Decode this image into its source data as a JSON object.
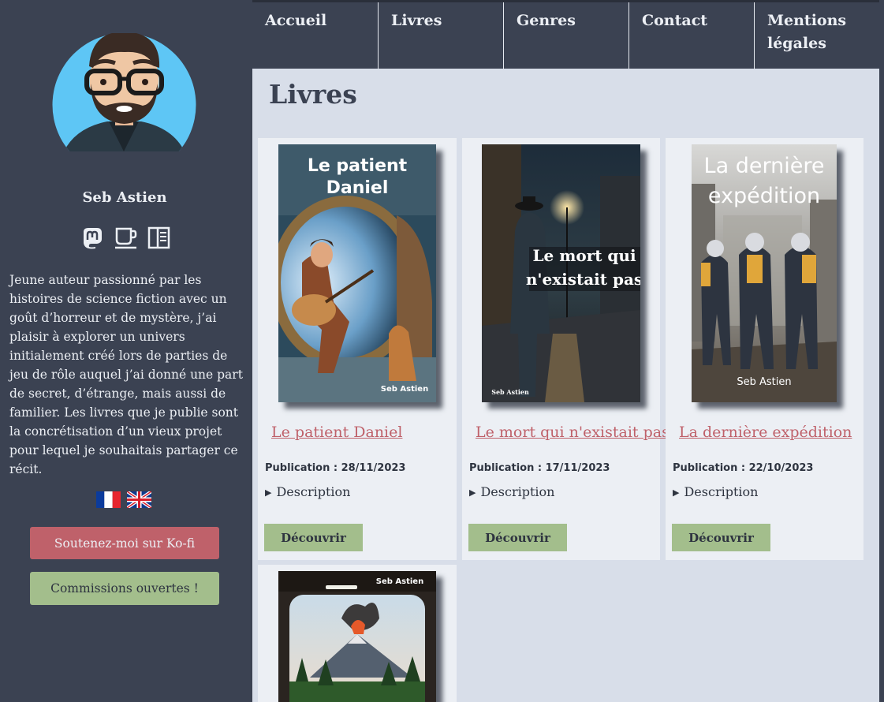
{
  "nav": {
    "items": [
      {
        "label": "Accueil"
      },
      {
        "label": "Livres"
      },
      {
        "label": "Genres"
      },
      {
        "label": "Contact"
      },
      {
        "label": "Mentions légales"
      }
    ]
  },
  "sidebar": {
    "author_name": "Seb Astien",
    "social_icons": [
      "mastodon-icon",
      "coffee-cup-icon",
      "book-icon"
    ],
    "bio": "Jeune auteur passionné par les histoires de science fiction avec un goût d’horreur et de mystère, j’ai plaisir à explorer un univers initialement créé lors de parties de jeu de rôle auquel j’ai donné une part de secret, d’étrange, mais aussi de familier. Les livres que je publie sont la concrétisation d’un vieux projet pour lequel je souhaitais partager ce récit.",
    "flags": [
      "french-flag-icon",
      "uk-flag-icon"
    ],
    "kofi_button": "Soutenez-moi sur Ko-fi",
    "commissions_button": "Commissions ouvertes !"
  },
  "main": {
    "title": "Livres",
    "books": [
      {
        "title": "Le patient Daniel",
        "cover_title": "Le patient Daniel",
        "cover_author": "Seb Astien",
        "date_label": "Publication :",
        "date": "28/11/2023",
        "description_label": "Description",
        "button": "Découvrir"
      },
      {
        "title": "Le mort qui n'existait pas",
        "cover_title": "Le mort qui n'existait pas",
        "cover_author": "Seb Astien",
        "date_label": "Publication :",
        "date": "17/11/2023",
        "description_label": "Description",
        "button": "Découvrir"
      },
      {
        "title": "La dernière expédition",
        "cover_title": "La dernière expédition",
        "cover_author": "Seb Astien",
        "date_label": "Publication :",
        "date": "22/10/2023",
        "description_label": "Description",
        "button": "Découvrir"
      },
      {
        "cover_author": "Seb Astien"
      }
    ]
  },
  "colors": {
    "dark": "#3b4252",
    "panel": "#d8dee9",
    "card": "#eceff4",
    "accent_red": "#bf616a",
    "accent_green": "#a3be8c"
  }
}
